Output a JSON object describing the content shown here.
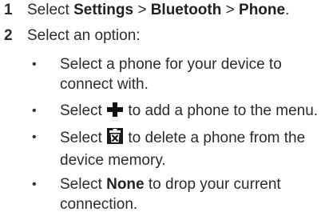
{
  "steps": [
    {
      "number": "1",
      "t1": "Select ",
      "b1": "Settings",
      "s1": " > ",
      "b2": "Bluetooth",
      "s2": " > ",
      "b3": "Phone",
      "end": "."
    },
    {
      "number": "2",
      "text": "Select an option:"
    }
  ],
  "bullets": [
    {
      "text": "Select a phone for your device to connect with."
    },
    {
      "pre": "Select ",
      "icon": "plus-icon",
      "post": " to add a phone to the menu."
    },
    {
      "pre": "Select ",
      "icon": "trash-icon",
      "post": " to delete a phone from the device memory."
    },
    {
      "pre": "Select ",
      "bold": "None",
      "post": " to drop your current connection."
    }
  ],
  "bullet_symbol": "•"
}
